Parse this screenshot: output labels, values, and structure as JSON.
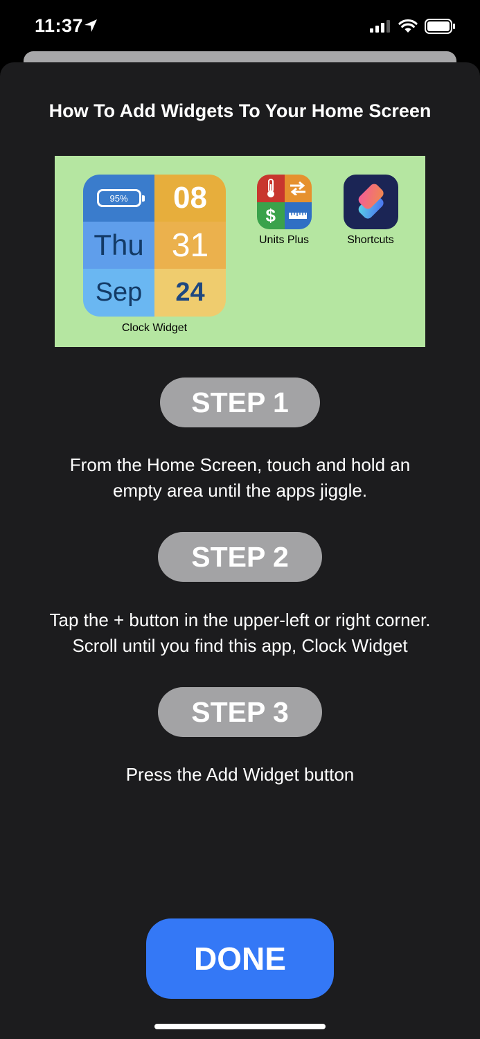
{
  "status_bar": {
    "time": "11:37"
  },
  "sheet": {
    "title": "How To Add Widgets To Your Home Screen",
    "preview": {
      "clock_widget": {
        "battery": "95%",
        "hour": "08",
        "day": "Thu",
        "minute": "31",
        "month": "Sep",
        "date": "24",
        "label": "Clock Widget"
      },
      "apps": [
        {
          "name": "Units Plus",
          "icon": "units-plus-icon"
        },
        {
          "name": "Shortcuts",
          "icon": "shortcuts-icon"
        }
      ]
    },
    "steps": [
      {
        "label": "STEP 1",
        "text_lines": [
          "From the Home Screen, touch and hold an",
          "empty area until the apps jiggle."
        ]
      },
      {
        "label": "STEP 2",
        "text_lines": [
          "Tap the + button in the upper-left or right corner.",
          "Scroll until you find this app, Clock Widget"
        ]
      },
      {
        "label": "STEP 3",
        "text_lines": [
          "Press the Add Widget button"
        ]
      }
    ],
    "done_label": "DONE"
  },
  "colors": {
    "accent_blue": "#3478f6",
    "sheet_bg": "#1c1c1e",
    "step_pill": "#a3a3a5",
    "preview_bg": "#b5e6a1"
  }
}
